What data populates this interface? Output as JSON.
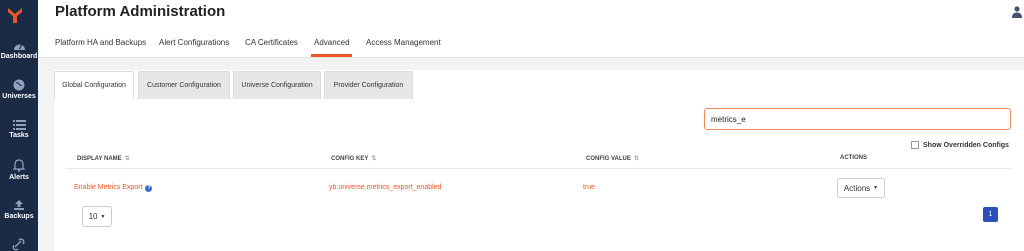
{
  "app": {
    "title": "Platform Administration"
  },
  "sidebar": {
    "items": [
      {
        "label": "Dashboard",
        "icon": "dashboard-icon"
      },
      {
        "label": "Universes",
        "icon": "globe-icon"
      },
      {
        "label": "Tasks",
        "icon": "list-icon"
      },
      {
        "label": "Alerts",
        "icon": "bell-icon"
      },
      {
        "label": "Backups",
        "icon": "upload-icon"
      }
    ]
  },
  "top_tabs": [
    {
      "label": "Platform HA and Backups"
    },
    {
      "label": "Alert Configurations"
    },
    {
      "label": "CA Certificates"
    },
    {
      "label": "Advanced"
    },
    {
      "label": "Access Management"
    }
  ],
  "sub_tabs": [
    {
      "label": "Global Configuration"
    },
    {
      "label": "Customer Configuration"
    },
    {
      "label": "Universe Configuration"
    },
    {
      "label": "Provider Configuration"
    }
  ],
  "search": {
    "value": "metrics_e"
  },
  "filter": {
    "label": "Show Overridden Configs"
  },
  "table": {
    "headers": [
      "DISPLAY NAME",
      "CONFIG KEY",
      "CONFIG VALUE",
      "ACTIONS"
    ],
    "rows": [
      {
        "display_name": "Enable Metrics Export",
        "config_key": "yb.universe.metrics_export_enabled",
        "config_value": "true",
        "action_label": "Actions"
      }
    ]
  },
  "pagination": {
    "page_size": "10",
    "current_page": "1"
  },
  "colors": {
    "accent": "#ef5824",
    "sidebar": "#1b2a45",
    "page_active": "#2f4dbb"
  }
}
